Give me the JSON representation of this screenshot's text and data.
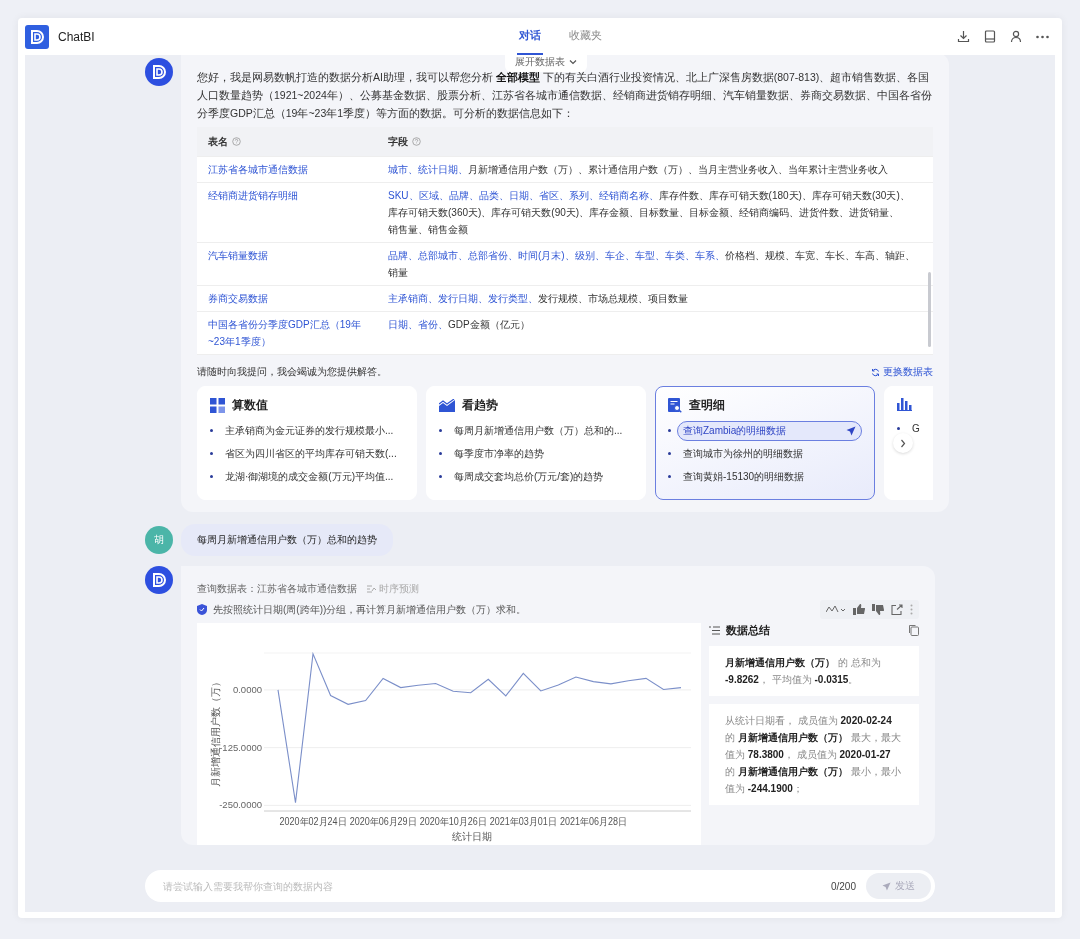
{
  "app": {
    "name": "ChatBI"
  },
  "tabs": [
    {
      "label": "对话",
      "selected": true
    },
    {
      "label": "收藏夹",
      "selected": false
    }
  ],
  "expand_tab": {
    "label": "展开数据表"
  },
  "welcome": {
    "intro": "您好，我是网易数帆打造的数据分析AI助理，我可以帮您分析 **全部模型** 下的有关白酒行业投资情况、北上广深售房数据(807-813)、超市销售数据、各国人口数量趋势（1921~2024年）、公募基金数据、股票分析、江苏省各城市通信数据、经销商进货销存明细、汽车销量数据、券商交易数据、中国各省份分季度GDP汇总（19年~23年1季度）等方面的数据。可分析的数据信息如下：",
    "table": {
      "columns": [
        "表名",
        "字段"
      ],
      "rows": [
        {
          "name": "江苏省各城市通信数据",
          "fields": [
            {
              "text": "城市、",
              "kind": "dimension"
            },
            {
              "text": "统计日期、",
              "kind": "dimension"
            },
            {
              "text": "月新增通信用户数（万）、",
              "kind": "measure"
            },
            {
              "text": "累计通信用户数（万）、",
              "kind": "measure"
            },
            {
              "text": "当月主营业务收入、",
              "kind": "measure"
            },
            {
              "text": "当年累计主营业务收入",
              "kind": "measure"
            }
          ]
        },
        {
          "name": "经销商进货销存明细",
          "fields": [
            {
              "text": "SKU、",
              "kind": "dimension"
            },
            {
              "text": "区域、",
              "kind": "dimension"
            },
            {
              "text": "品牌、",
              "kind": "dimension"
            },
            {
              "text": "品类、",
              "kind": "dimension"
            },
            {
              "text": "日期、",
              "kind": "dimension"
            },
            {
              "text": "省区、",
              "kind": "dimension"
            },
            {
              "text": "系列、",
              "kind": "dimension"
            },
            {
              "text": "经销商名称、",
              "kind": "dimension"
            },
            {
              "text": "库存件数、",
              "kind": "measure"
            },
            {
              "text": "库存可销天数(180天)、",
              "kind": "measure"
            },
            {
              "text": "库存可销天数(30天)、",
              "kind": "measure"
            },
            {
              "text": "库存可销天数(360天)、",
              "kind": "measure"
            },
            {
              "text": "库存可销天数(90天)、",
              "kind": "measure"
            },
            {
              "text": "库存金额、",
              "kind": "measure"
            },
            {
              "text": "目标数量、",
              "kind": "measure"
            },
            {
              "text": "目标金额、",
              "kind": "measure"
            },
            {
              "text": "经销商编码、",
              "kind": "measure"
            },
            {
              "text": "进货件数、",
              "kind": "measure"
            },
            {
              "text": "进货销量、",
              "kind": "measure"
            },
            {
              "text": "销售量、",
              "kind": "measure"
            },
            {
              "text": "销售金额",
              "kind": "measure"
            }
          ]
        },
        {
          "name": "汽车销量数据",
          "fields": [
            {
              "text": "品牌、",
              "kind": "dimension"
            },
            {
              "text": "总部城市、",
              "kind": "dimension"
            },
            {
              "text": "总部省份、",
              "kind": "dimension"
            },
            {
              "text": "时间(月末)、",
              "kind": "dimension"
            },
            {
              "text": "级别、",
              "kind": "dimension"
            },
            {
              "text": "车企、",
              "kind": "dimension"
            },
            {
              "text": "车型、",
              "kind": "dimension"
            },
            {
              "text": "车类、",
              "kind": "dimension"
            },
            {
              "text": "车系、",
              "kind": "dimension"
            },
            {
              "text": "价格档、",
              "kind": "measure"
            },
            {
              "text": "规模、",
              "kind": "measure"
            },
            {
              "text": "车宽、",
              "kind": "measure"
            },
            {
              "text": "车长、",
              "kind": "measure"
            },
            {
              "text": "车高、",
              "kind": "measure"
            },
            {
              "text": "轴距、",
              "kind": "measure"
            },
            {
              "text": "销量",
              "kind": "measure"
            }
          ]
        },
        {
          "name": "券商交易数据",
          "fields": [
            {
              "text": "主承销商、",
              "kind": "dimension"
            },
            {
              "text": "发行日期、",
              "kind": "dimension"
            },
            {
              "text": "发行类型、",
              "kind": "dimension"
            },
            {
              "text": "发行规模、",
              "kind": "measure"
            },
            {
              "text": "市场总规模、",
              "kind": "measure"
            },
            {
              "text": "项目数量",
              "kind": "measure"
            }
          ]
        },
        {
          "name": "中国各省份分季度GDP汇总（19年~23年1季度）",
          "fields": [
            {
              "text": "日期、",
              "kind": "dimension"
            },
            {
              "text": "省份、",
              "kind": "dimension"
            },
            {
              "text": "GDP金额（亿元）",
              "kind": "measure"
            }
          ]
        }
      ]
    },
    "prompt": "请随时向我提问，我会竭诚为您提供解答。",
    "switch_link": "更换数据表",
    "cards": [
      {
        "kind": "value",
        "title": "算数值",
        "selected": false,
        "items": [
          {
            "text": "主承销商为金元证券的发行规模最小...",
            "highlighted": false
          },
          {
            "text": "省区为四川省区的平均库存可销天数(...",
            "highlighted": false
          },
          {
            "text": "龙湖·御湖境的成交金额(万元)平均值...",
            "highlighted": false
          }
        ]
      },
      {
        "kind": "trend",
        "title": "看趋势",
        "selected": false,
        "items": [
          {
            "text": "每周月新增通信用户数（万）总和的...",
            "highlighted": false
          },
          {
            "text": "每季度市净率的趋势",
            "highlighted": false
          },
          {
            "text": "每周成交套均总价(万元/套)的趋势",
            "highlighted": false
          }
        ]
      },
      {
        "kind": "detail",
        "title": "查明细",
        "selected": true,
        "items": [
          {
            "text": "查询Zambia的明细数据",
            "highlighted": true
          },
          {
            "text": "查询城市为徐州的明细数据",
            "highlighted": false
          },
          {
            "text": "查询黄娟-15130的明细数据",
            "highlighted": false
          }
        ]
      },
      {
        "kind": "bars",
        "selected": false,
        "items": [
          {
            "text": "G",
            "highlighted": false
          }
        ]
      }
    ]
  },
  "user_message": {
    "avatar": "胡",
    "text": "每周月新增通信用户数（万）总和的趋势"
  },
  "answer": {
    "source_label": "查询数据表：",
    "source_table": "江苏省各城市通信数据",
    "forecast": "时序预测",
    "explanation": "先按照统计日期(周(跨年))分组，再计算月新增通信用户数（万）求和。",
    "chart_data": {
      "type": "line",
      "ylabel": "月新增通信用户数（万）",
      "xlabel": "统计日期",
      "categories": [
        null,
        null,
        "2020年02月24日",
        null,
        null,
        null,
        "2020年06月29日",
        null,
        null,
        null,
        "2020年10月26日",
        null,
        null,
        null,
        "2021年03月01日",
        null,
        null,
        null,
        "2021年06月28日",
        null,
        null,
        null,
        null,
        null
      ],
      "series": [
        {
          "color": "#7b8fc9",
          "values": [
            0,
            -244,
            78,
            -12,
            -31,
            -23,
            25,
            5,
            10,
            14,
            -3,
            -6,
            23,
            -13,
            36,
            -2,
            11,
            28,
            18,
            13,
            20,
            25,
            1,
            5
          ]
        }
      ],
      "grid": true,
      "ylim": [
        -260,
        80
      ],
      "yticks": [
        {
          "value": 0,
          "label": "0.0000"
        },
        {
          "value": -125,
          "label": "-125.0000"
        },
        {
          "value": -250,
          "label": "-250.0000"
        }
      ]
    },
    "summary": {
      "title": "数据总结",
      "paragraphs": [
        "**月新增通信用户数（万）** 的 总和为 **-9.8262**， 平均值为 **-0.0315**。",
        "从统计日期看， 成员值为 **2020-02-24** 的 **月新增通信用户数（万）** 最大，最大值为 **78.3800**， 成员值为 **2020-01-27** 的 **月新增通信用户数（万）** 最小，最小值为 **-244.1900**；"
      ]
    }
  },
  "input": {
    "placeholder": "请尝试输入需要我帮你查询的数据内容",
    "counter": "0/200",
    "send": "发送"
  }
}
